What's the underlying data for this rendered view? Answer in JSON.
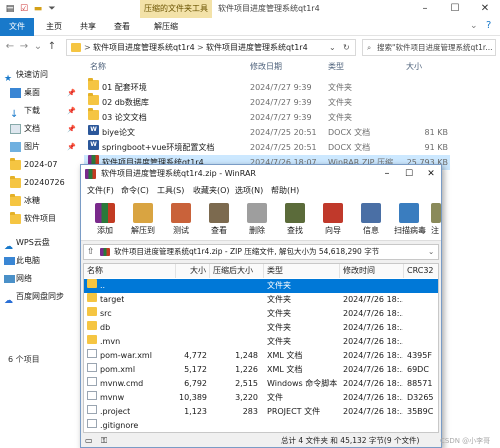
{
  "explorer": {
    "contextual_tab": "压缩的文件夹工具",
    "title": "软件项目进度管理系统qt1r4",
    "ribbon_tabs": [
      "文件",
      "主页",
      "共享",
      "查看",
      "解压缩"
    ],
    "address": {
      "path": [
        "软件项目进度管理系统qt1r4",
        "软件项目进度管理系统qt1r4"
      ],
      "separator": ">"
    },
    "search_placeholder": "搜索\"软件项目进度管理系统qt1r...",
    "columns": [
      "名称",
      "修改日期",
      "类型",
      "大小"
    ],
    "files": [
      {
        "name": "01 配套环境",
        "date": "2024/7/27 9:39",
        "type": "文件夹",
        "size": "",
        "icon": "folder-icon"
      },
      {
        "name": "02 db数据库",
        "date": "2024/7/27 9:39",
        "type": "文件夹",
        "size": "",
        "icon": "folder-icon"
      },
      {
        "name": "03 论文文档",
        "date": "2024/7/27 9:39",
        "type": "文件夹",
        "size": "",
        "icon": "folder-icon"
      },
      {
        "name": "biye论文",
        "date": "2024/7/25 20:51",
        "type": "DOCX 文档",
        "size": "81 KB",
        "icon": "docx-icon"
      },
      {
        "name": "springboot+vue环境配置文档",
        "date": "2024/7/25 20:51",
        "type": "DOCX 文档",
        "size": "91 KB",
        "icon": "docx-icon"
      },
      {
        "name": "软件项目进度管理系统qt1r4",
        "date": "2024/7/26 18:07",
        "type": "WinRAR ZIP 压缩...",
        "size": "25,793 KB",
        "icon": "winrar-icon"
      }
    ],
    "nav": [
      {
        "label": "快速访问",
        "icon": "star-icon",
        "pinned": false
      },
      {
        "label": "桌面",
        "icon": "desktop-icon",
        "pinned": true
      },
      {
        "label": "下载",
        "icon": "download-icon",
        "pinned": true
      },
      {
        "label": "文档",
        "icon": "document-icon",
        "pinned": true
      },
      {
        "label": "图片",
        "icon": "picture-icon",
        "pinned": true
      },
      {
        "label": "2024-07",
        "icon": "folder-icon",
        "pinned": false
      },
      {
        "label": "20240726",
        "icon": "folder-icon",
        "pinned": false
      },
      {
        "label": "冰糖",
        "icon": "folder-icon",
        "pinned": false
      },
      {
        "label": "软件项目",
        "icon": "folder-icon",
        "pinned": false
      },
      {
        "label": "WPS云盘",
        "icon": "cloud-icon",
        "pinned": false
      },
      {
        "label": "此电脑",
        "icon": "computer-icon",
        "pinned": false
      },
      {
        "label": "网络",
        "icon": "network-icon",
        "pinned": false
      },
      {
        "label": "百度网盘同步",
        "icon": "baidu-icon",
        "pinned": false
      }
    ],
    "status": "6 个项目"
  },
  "winrar": {
    "title": "软件项目进度管理系统qt1r4.zip - WinRAR",
    "menu": [
      "文件(F)",
      "命令(C)",
      "工具(S)",
      "收藏夹(O)",
      "选项(N)",
      "帮助(H)"
    ],
    "toolbar": [
      {
        "label": "添加",
        "icon": "add-archive-icon"
      },
      {
        "label": "解压到",
        "icon": "extract-to-icon"
      },
      {
        "label": "测试",
        "icon": "test-icon"
      },
      {
        "label": "查看",
        "icon": "view-icon"
      },
      {
        "label": "删除",
        "icon": "delete-icon"
      },
      {
        "label": "查找",
        "icon": "find-icon"
      },
      {
        "label": "向导",
        "icon": "wizard-icon"
      },
      {
        "label": "信息",
        "icon": "info-icon"
      },
      {
        "label": "扫描病毒",
        "icon": "scan-virus-icon"
      },
      {
        "label": "注",
        "icon": "comment-icon"
      }
    ],
    "path_bar": "软件项目进度管理系统qt1r4.zip - ZIP 压缩文件, 解包大小为 54,618,290 字节",
    "columns": [
      "名称",
      "大小",
      "压缩后大小",
      "类型",
      "修改时间",
      "CRC32"
    ],
    "rows": [
      {
        "name": "..",
        "size": "",
        "packed": "",
        "type": "文件夹",
        "modified": "",
        "crc": "",
        "kind": "folder",
        "selected": true
      },
      {
        "name": "target",
        "size": "",
        "packed": "",
        "type": "文件夹",
        "modified": "2024/7/26 18:...",
        "crc": "",
        "kind": "folder",
        "selected": false
      },
      {
        "name": "src",
        "size": "",
        "packed": "",
        "type": "文件夹",
        "modified": "2024/7/26 18:...",
        "crc": "",
        "kind": "folder",
        "selected": false
      },
      {
        "name": "db",
        "size": "",
        "packed": "",
        "type": "文件夹",
        "modified": "2024/7/26 18:...",
        "crc": "",
        "kind": "folder",
        "selected": false
      },
      {
        "name": ".mvn",
        "size": "",
        "packed": "",
        "type": "文件夹",
        "modified": "2024/7/26 18:...",
        "crc": "",
        "kind": "folder",
        "selected": false
      },
      {
        "name": "pom-war.xml",
        "size": "4,772",
        "packed": "1,248",
        "type": "XML 文档",
        "modified": "2024/7/26 18:...",
        "crc": "4395F",
        "kind": "file",
        "selected": false
      },
      {
        "name": "pom.xml",
        "size": "5,172",
        "packed": "1,226",
        "type": "XML 文档",
        "modified": "2024/7/26 18:...",
        "crc": "69DC",
        "kind": "file",
        "selected": false
      },
      {
        "name": "mvnw.cmd",
        "size": "6,792",
        "packed": "2,515",
        "type": "Windows 命令脚本",
        "modified": "2024/7/26 18:...",
        "crc": "88571",
        "kind": "file",
        "selected": false
      },
      {
        "name": "mvnw",
        "size": "10,389",
        "packed": "3,220",
        "type": "文件",
        "modified": "2024/7/26 18:...",
        "crc": "D3265",
        "kind": "file",
        "selected": false
      },
      {
        "name": ".project",
        "size": "1,123",
        "packed": "283",
        "type": "PROJECT 文件",
        "modified": "2024/7/26 18:...",
        "crc": "35B9C",
        "kind": "file",
        "selected": false
      },
      {
        "name": ".gitignore",
        "size": "",
        "packed": "",
        "type": "",
        "modified": "",
        "crc": "",
        "kind": "file",
        "selected": false
      }
    ],
    "status_left": "",
    "status_right": "总计 4 文件夹 和 45,132 字节(9 个文件)"
  },
  "watermark": "CSDN @小李哥",
  "colors": {
    "accent": "#1979ca",
    "selection": "#cce8ff",
    "rar_selection": "#0078d7",
    "contextual_tab": "#f3e2a8"
  }
}
